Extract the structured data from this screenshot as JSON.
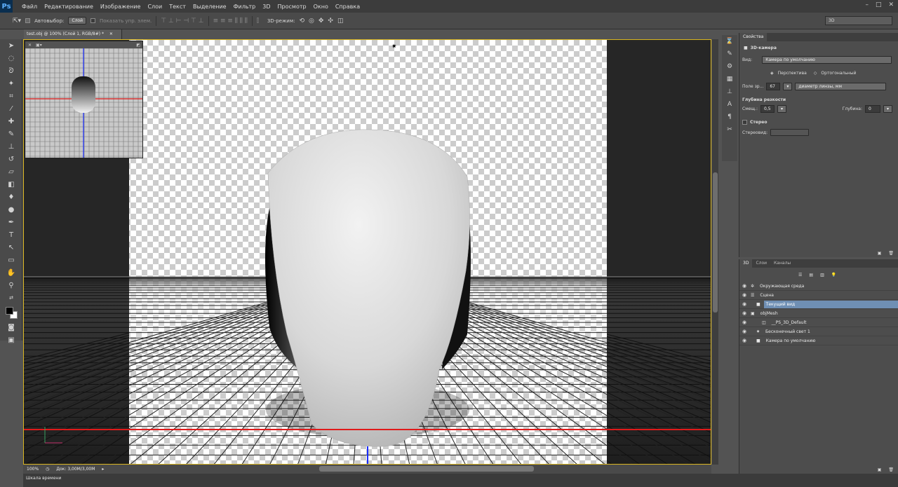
{
  "app": {
    "logo": "Ps"
  },
  "menu": [
    "Файл",
    "Редактирование",
    "Изображение",
    "Слои",
    "Текст",
    "Выделение",
    "Фильтр",
    "3D",
    "Просмотр",
    "Окно",
    "Справка"
  ],
  "window_controls": [
    "–",
    "□",
    "✕"
  ],
  "options": {
    "autoselect_label": "Автовыбор:",
    "autoselect_value": "Слой",
    "show_controls_label": "Показать упр. элем.",
    "mode_label": "3D-режим:",
    "workspace": "3D"
  },
  "document": {
    "tab_title": "test.obj @ 100% (Слой 1, RGB/8#) *",
    "zoom": "100%",
    "doc_size": "Док: 3,00M/3,00M"
  },
  "timeline": {
    "label": "Шкала времени"
  },
  "properties": {
    "tab": "Свойства",
    "title": "3D-камера",
    "view_label": "Вид:",
    "view_value": "Камера по умолчанию",
    "perspective": "Перспектива",
    "orthographic": "Ортогональный",
    "fov_label": "Поле зр...",
    "fov_value": "67",
    "lens_value": "диаметр линзы, мм",
    "dof_title": "Глубина резкости",
    "offset_label": "Смещ.:",
    "offset_value": "0,5",
    "depth_label": "Глубина:",
    "depth_value": "0",
    "stereo_label": "Стерео",
    "stereo_type_label": "Стереовид:"
  },
  "panel3d": {
    "tabs": [
      "3D",
      "Слои",
      "Каналы"
    ],
    "items": [
      {
        "label": "Окружающая среда",
        "icon": "environment-icon",
        "indent": 0,
        "selected": false
      },
      {
        "label": "Сцена",
        "icon": "scene-icon",
        "indent": 0,
        "selected": false
      },
      {
        "label": "Текущий вид",
        "icon": "camera-icon",
        "indent": 1,
        "selected": true
      },
      {
        "label": "objMesh",
        "icon": "mesh-icon",
        "indent": 0,
        "selected": false
      },
      {
        "label": "__PS_3D_Default",
        "icon": "material-icon",
        "indent": 2,
        "selected": false
      },
      {
        "label": "Бесконечный свет 1",
        "icon": "light-icon",
        "indent": 1,
        "selected": false
      },
      {
        "label": "Камера по умолчанию",
        "icon": "camera-icon",
        "indent": 1,
        "selected": false
      }
    ]
  }
}
